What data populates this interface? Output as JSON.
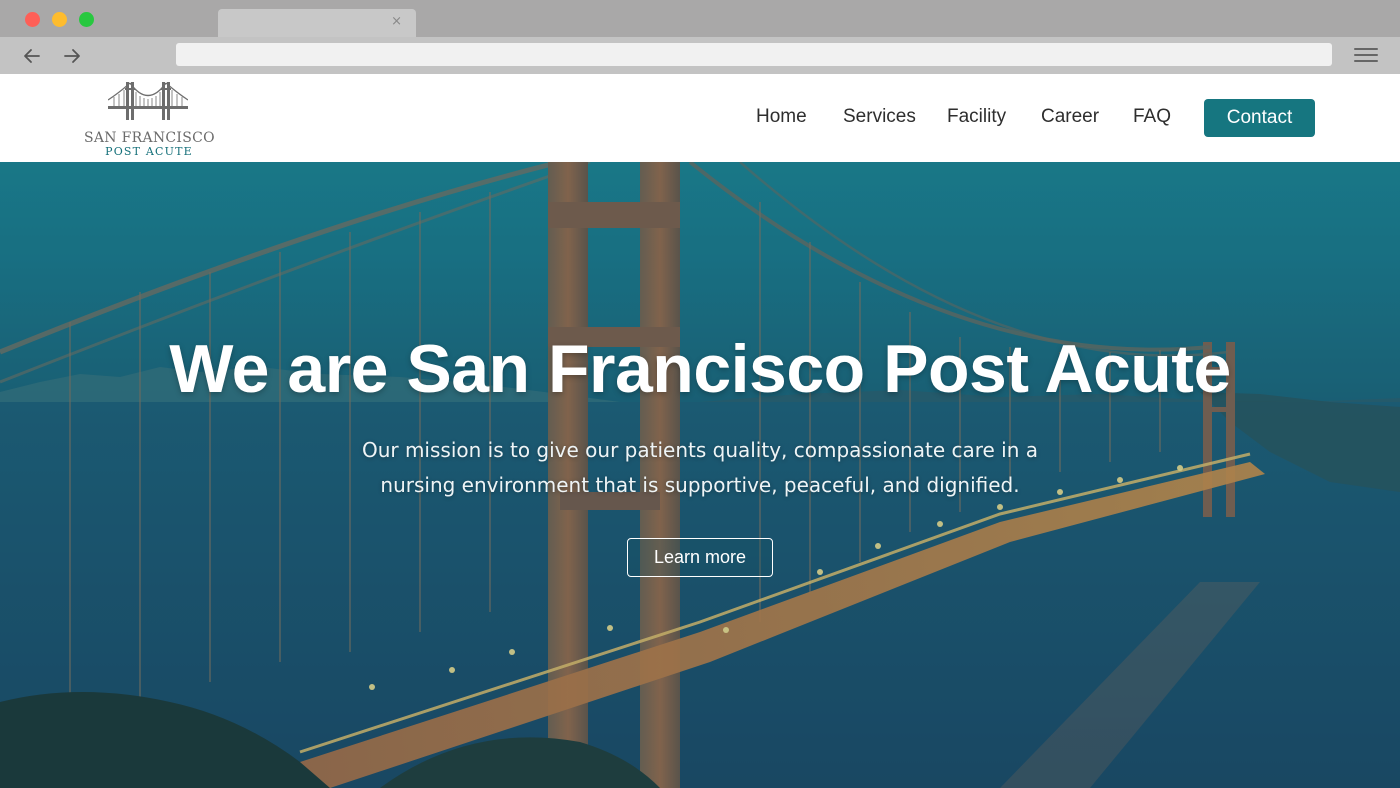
{
  "browser": {
    "tab_title": "",
    "tab_close": "×",
    "url": ""
  },
  "site": {
    "logo": {
      "line1": "SAN FRANCISCO",
      "line2": "POST ACUTE",
      "icon": "golden-gate-bridge-icon"
    },
    "nav": {
      "items": [
        {
          "label": "Home"
        },
        {
          "label": "Services"
        },
        {
          "label": "Facility"
        },
        {
          "label": "Career"
        },
        {
          "label": "FAQ"
        }
      ],
      "contact_label": "Contact"
    },
    "hero": {
      "title": "We are San Francisco Post Acute",
      "mission_line1": "Our mission is to give our patients quality, compassionate care in a",
      "mission_line2": "nursing environment that is supportive, peaceful, and dignified.",
      "cta_label": "Learn more"
    }
  },
  "colors": {
    "accent": "#167680",
    "nav_text": "#2e2e2e",
    "logo_gray": "#6b6b6b",
    "logo_teal": "#15707a"
  }
}
